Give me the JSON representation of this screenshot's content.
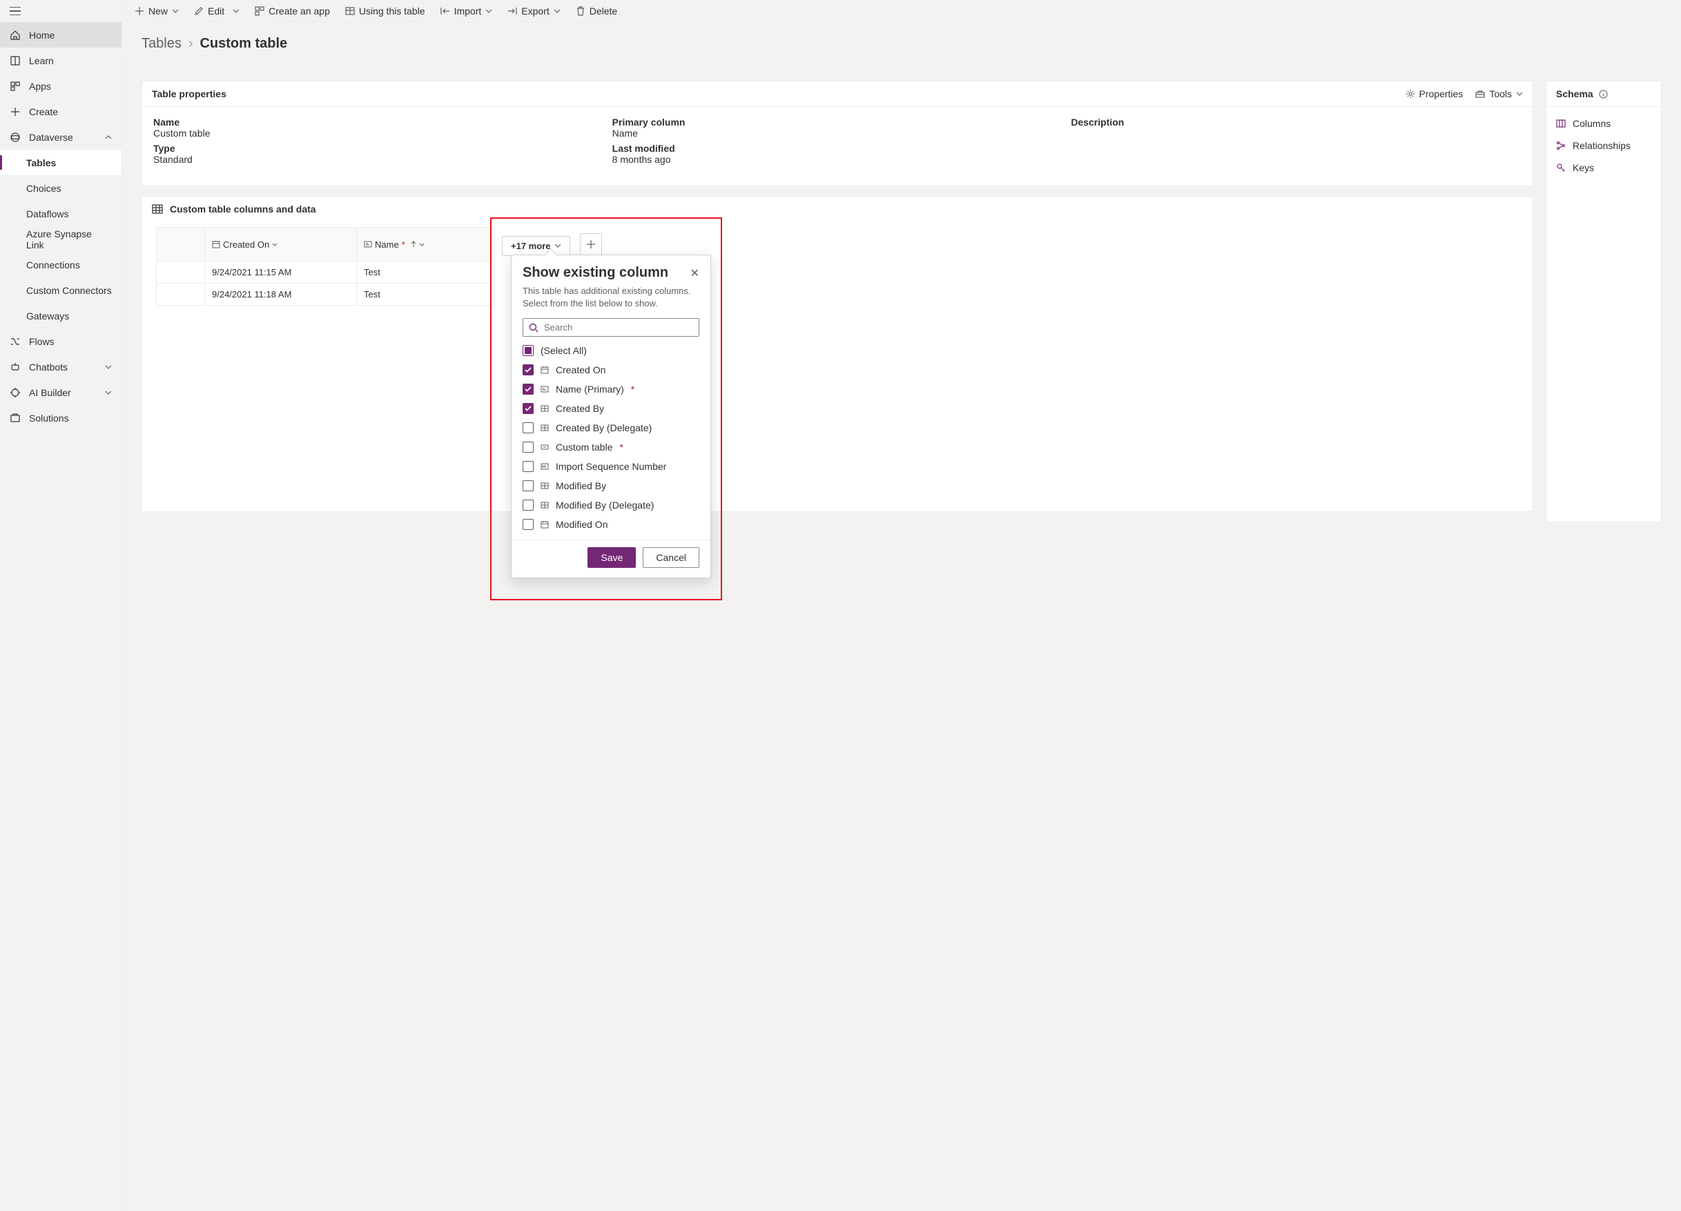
{
  "nav": {
    "home": "Home",
    "learn": "Learn",
    "apps": "Apps",
    "create": "Create",
    "dataverse": "Dataverse",
    "dataverse_children": [
      "Tables",
      "Choices",
      "Dataflows",
      "Azure Synapse Link",
      "Connections",
      "Custom Connectors",
      "Gateways"
    ],
    "flows": "Flows",
    "chatbots": "Chatbots",
    "ai_builder": "AI Builder",
    "solutions": "Solutions"
  },
  "commands": {
    "new": "New",
    "edit": "Edit",
    "create_app": "Create an app",
    "using_table": "Using this table",
    "import": "Import",
    "export": "Export",
    "delete": "Delete"
  },
  "breadcrumb": {
    "parent": "Tables",
    "current": "Custom table"
  },
  "props": {
    "title": "Table properties",
    "properties_link": "Properties",
    "tools_link": "Tools",
    "name_label": "Name",
    "name_value": "Custom table",
    "primary_label": "Primary column",
    "primary_value": "Name",
    "desc_label": "Description",
    "type_label": "Type",
    "type_value": "Standard",
    "modified_label": "Last modified",
    "modified_value": "8 months ago"
  },
  "schema": {
    "title": "Schema",
    "columns": "Columns",
    "relationships": "Relationships",
    "keys": "Keys"
  },
  "data": {
    "header": "Custom table columns and data",
    "col1": "Created On",
    "col2": "Name",
    "more": "+17 more",
    "rows": [
      {
        "created": "9/24/2021 11:15 AM",
        "name": "Test"
      },
      {
        "created": "9/24/2021 11:18 AM",
        "name": "Test"
      }
    ]
  },
  "flyout": {
    "title": "Show existing column",
    "desc": "This table has additional existing columns. Select from the list below to show.",
    "search_placeholder": "Search",
    "select_all": "(Select All)",
    "save": "Save",
    "cancel": "Cancel",
    "items": [
      {
        "label": "Created On",
        "checked": true,
        "icon": "date"
      },
      {
        "label": "Name (Primary)",
        "checked": true,
        "icon": "text",
        "required": true
      },
      {
        "label": "Created By",
        "checked": true,
        "icon": "lookup"
      },
      {
        "label": "Created By (Delegate)",
        "checked": false,
        "icon": "lookup"
      },
      {
        "label": "Custom table",
        "checked": false,
        "icon": "key",
        "required": true
      },
      {
        "label": "Import Sequence Number",
        "checked": false,
        "icon": "number"
      },
      {
        "label": "Modified By",
        "checked": false,
        "icon": "lookup"
      },
      {
        "label": "Modified By (Delegate)",
        "checked": false,
        "icon": "lookup"
      },
      {
        "label": "Modified On",
        "checked": false,
        "icon": "date"
      }
    ]
  }
}
